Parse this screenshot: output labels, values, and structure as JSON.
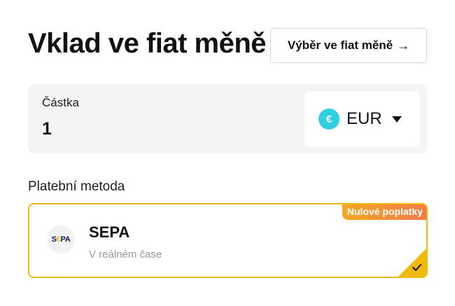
{
  "header": {
    "title": "Vklad ve fiat měně",
    "withdraw_button": "Výběr ve fiat měně",
    "withdraw_arrow": "→"
  },
  "amount": {
    "label": "Částka",
    "value": "1"
  },
  "currency": {
    "symbol": "€",
    "code": "EUR",
    "icon_color": "#2dcfe0"
  },
  "payment": {
    "label": "Platební metoda",
    "method": {
      "logo_prefix": "S",
      "logo_e": "€",
      "logo_suffix": "PA",
      "name": "SEPA",
      "subtitle": "V reálném čase",
      "badge": "Nulové poplatky",
      "selected": true
    }
  },
  "colors": {
    "accent": "#f0b90b",
    "badge_gradient_start": "#f5a623",
    "badge_gradient_end": "#f07a4a"
  }
}
